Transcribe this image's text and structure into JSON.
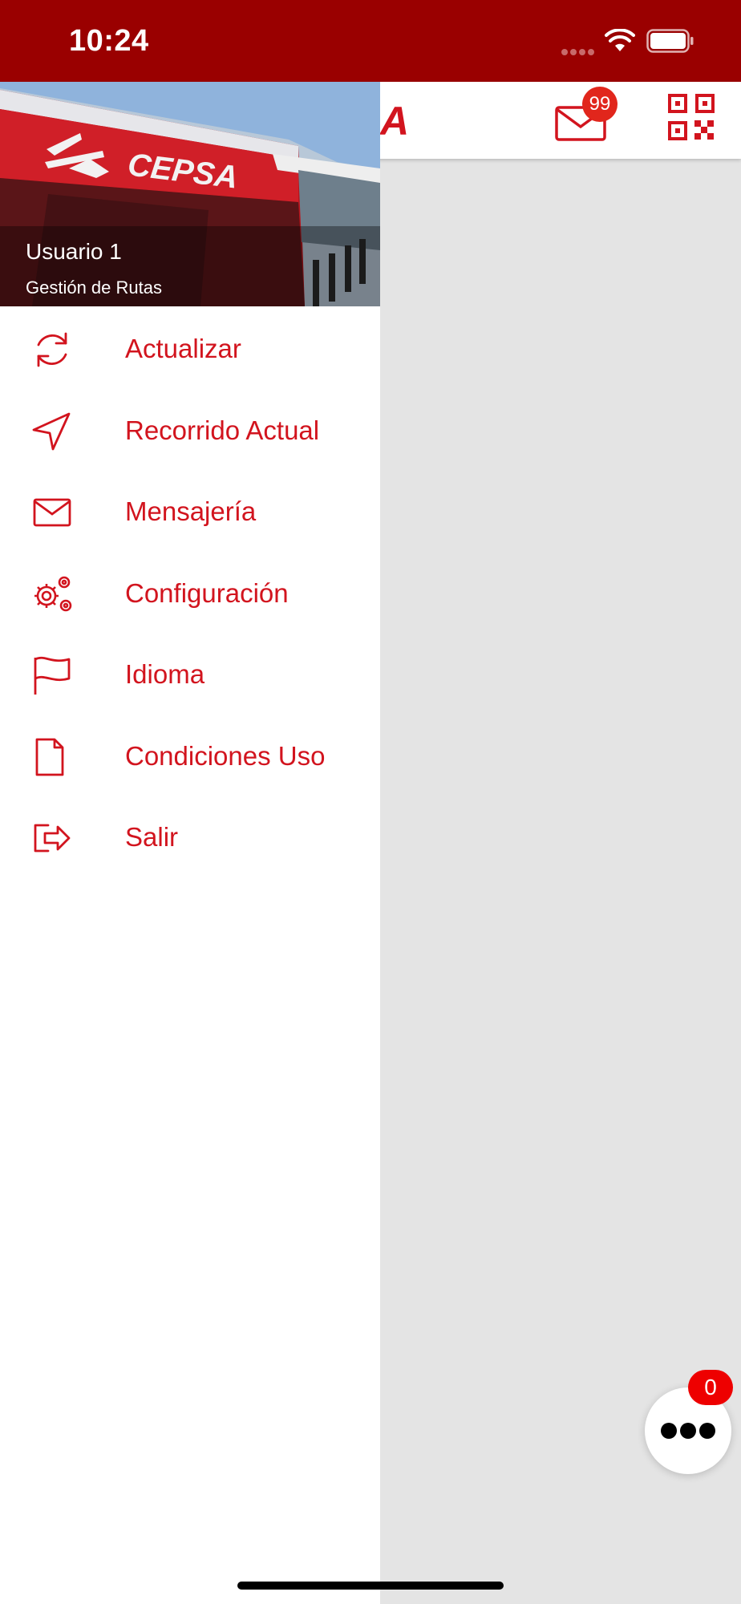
{
  "status_bar": {
    "time": "10:24"
  },
  "header": {
    "logo_text": "A",
    "mail_badge_count": "99"
  },
  "drawer": {
    "user_name": "Usuario 1",
    "user_role": "Gestión de Rutas",
    "header_logo_text": "CEPSA",
    "menu": [
      {
        "label": "Actualizar",
        "icon": "refresh-icon"
      },
      {
        "label": "Recorrido Actual",
        "icon": "navigation-arrow-icon"
      },
      {
        "label": "Mensajería",
        "icon": "envelope-icon"
      },
      {
        "label": "Configuración",
        "icon": "gears-icon"
      },
      {
        "label": "Idioma",
        "icon": "flag-icon"
      },
      {
        "label": "Condiciones Uso",
        "icon": "document-icon"
      },
      {
        "label": "Salir",
        "icon": "logout-icon"
      }
    ]
  },
  "fab": {
    "badge_count": "0"
  },
  "colors": {
    "status_bar": "#9a0000",
    "accent_red": "#d2141e",
    "background": "#e4e4e4",
    "badge_red": "#ee0000"
  }
}
